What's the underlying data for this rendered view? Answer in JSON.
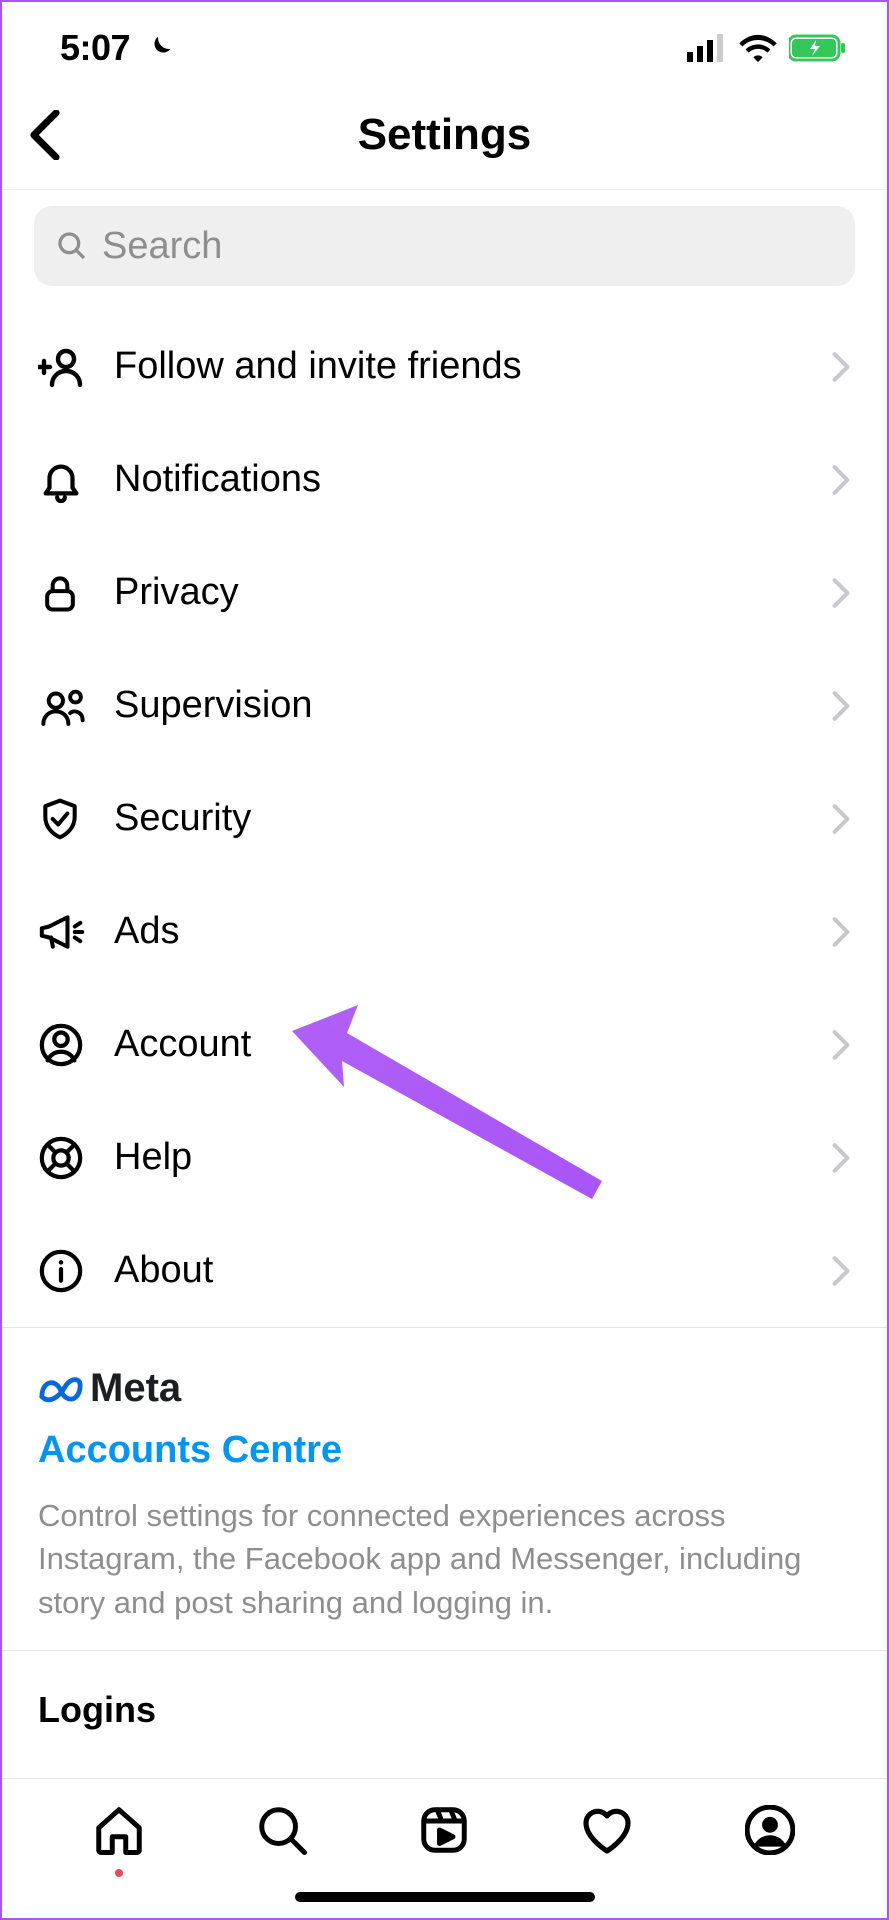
{
  "status": {
    "time": "5:07"
  },
  "header": {
    "title": "Settings"
  },
  "search": {
    "placeholder": "Search"
  },
  "menu": {
    "items": [
      {
        "icon": "user-plus-icon",
        "label": "Follow and invite friends"
      },
      {
        "icon": "bell-icon",
        "label": "Notifications"
      },
      {
        "icon": "lock-icon",
        "label": "Privacy"
      },
      {
        "icon": "people-icon",
        "label": "Supervision"
      },
      {
        "icon": "shield-check-icon",
        "label": "Security"
      },
      {
        "icon": "megaphone-icon",
        "label": "Ads"
      },
      {
        "icon": "user-circle-icon",
        "label": "Account"
      },
      {
        "icon": "lifebuoy-icon",
        "label": "Help"
      },
      {
        "icon": "info-icon",
        "label": "About"
      }
    ]
  },
  "meta": {
    "brand": "Meta",
    "link": "Accounts Centre",
    "description": "Control settings for connected experiences across Instagram, the Facebook app and Messenger, including story and post sharing and logging in."
  },
  "logins": {
    "heading": "Logins"
  },
  "annotation": {
    "target": "Account",
    "color": "#a855f7"
  }
}
